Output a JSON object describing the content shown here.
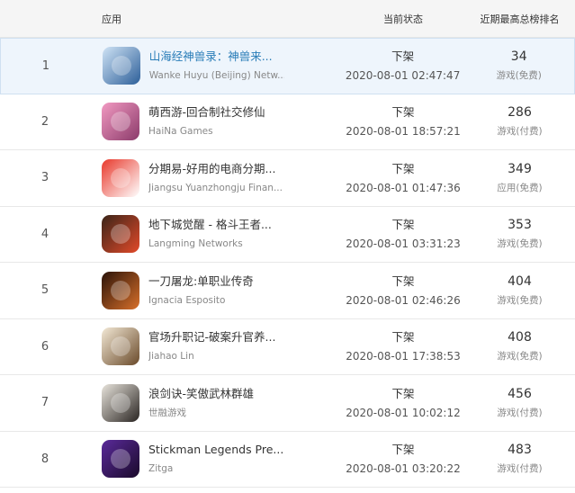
{
  "header": {
    "app": "应用",
    "status": "当前状态",
    "best_rank": "近期最高总榜排名"
  },
  "rows": [
    {
      "rank": "1",
      "name": "山海经神兽录：神兽来...",
      "developer": "Wanke Huyu (Beijing) Netw...",
      "status": "下架",
      "time": "2020-08-01 02:47:47",
      "best": "34",
      "category": "游戏(免费)",
      "icon": "shanhai-game-icon",
      "colors": [
        "#cfe3f5",
        "#2d5f99"
      ]
    },
    {
      "rank": "2",
      "name": "萌西游-回合制社交修仙",
      "developer": "HaiNa Games",
      "status": "下架",
      "time": "2020-08-01 18:57:21",
      "best": "286",
      "category": "游戏(付费)",
      "icon": "mengxiyou-game-icon",
      "colors": [
        "#f29ac2",
        "#8b3a6a"
      ]
    },
    {
      "rank": "3",
      "name": "分期易-好用的电商分期...",
      "developer": "Jiangsu Yuanzhongju Finan...",
      "status": "下架",
      "time": "2020-08-01 01:47:36",
      "best": "349",
      "category": "应用(免费)",
      "icon": "fenqiyi-app-icon",
      "colors": [
        "#e8382b",
        "#ffffff"
      ]
    },
    {
      "rank": "4",
      "name": "地下城觉醒 - 格斗王者...",
      "developer": "Langming Networks",
      "status": "下架",
      "time": "2020-08-01 03:31:23",
      "best": "353",
      "category": "游戏(免费)",
      "icon": "dungeon-game-icon",
      "colors": [
        "#3a2418",
        "#e24a2a"
      ]
    },
    {
      "rank": "5",
      "name": "一刀屠龙:单职业传奇",
      "developer": "Ignacia Esposito",
      "status": "下架",
      "time": "2020-08-01 02:46:26",
      "best": "404",
      "category": "游戏(免费)",
      "icon": "dragon-blade-game-icon",
      "colors": [
        "#2a1208",
        "#d8702a"
      ]
    },
    {
      "rank": "6",
      "name": "官场升职记-破案升官养...",
      "developer": "Jiahao Lin",
      "status": "下架",
      "time": "2020-08-01 17:38:53",
      "best": "408",
      "category": "游戏(免费)",
      "icon": "official-promotion-game-icon",
      "colors": [
        "#f3e9d6",
        "#6a4a2a"
      ]
    },
    {
      "rank": "7",
      "name": "浪剑诀-笑傲武林群雄",
      "developer": "世融游戏",
      "status": "下架",
      "time": "2020-08-01 10:02:12",
      "best": "456",
      "category": "游戏(付费)",
      "icon": "sword-game-icon",
      "colors": [
        "#e8e4dc",
        "#2a2522"
      ]
    },
    {
      "rank": "8",
      "name": "Stickman Legends Pre...",
      "developer": "Zitga",
      "status": "下架",
      "time": "2020-08-01 03:20:22",
      "best": "483",
      "category": "游戏(付费)",
      "icon": "stickman-game-icon",
      "colors": [
        "#5a2a9a",
        "#1a0a2a"
      ]
    }
  ]
}
